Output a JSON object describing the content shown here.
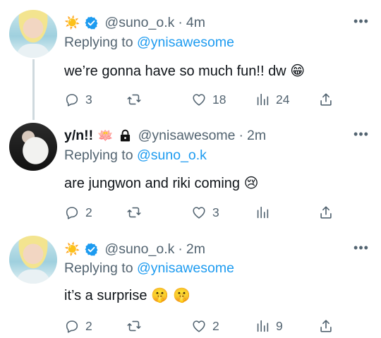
{
  "tweets": [
    {
      "display_name": "",
      "name_emoji": "☀️",
      "verified": true,
      "handle": "@suno_o.k",
      "time": "4m",
      "replying_prefix": "Replying to",
      "replying_to": "@ynisawesome",
      "text": "we’re gonna have so much fun!! dw ",
      "text_emoji": "😁",
      "counts": {
        "replies": "3",
        "retweets": "",
        "likes": "18",
        "views": "24"
      }
    },
    {
      "display_name": "y/n!!",
      "name_emoji": "🪷",
      "verified": false,
      "handle": "@ynisawesome",
      "time": "2m",
      "replying_prefix": "Replying to",
      "replying_to": "@suno_o.k",
      "text": "are jungwon and riki coming ",
      "text_emoji": "😢",
      "counts": {
        "replies": "2",
        "retweets": "",
        "likes": "3",
        "views": ""
      }
    },
    {
      "display_name": "",
      "name_emoji": "☀️",
      "verified": true,
      "handle": "@suno_o.k",
      "time": "2m",
      "replying_prefix": "Replying to",
      "replying_to": "@ynisawesome",
      "text": "it’s a surprise ",
      "text_emoji": "🤫 🤫",
      "counts": {
        "replies": "2",
        "retweets": "",
        "likes": "2",
        "views": "9"
      }
    }
  ],
  "more_glyph": "•••",
  "colors": {
    "accent": "#1d9bf0",
    "muted": "#536471",
    "text": "#0f1419",
    "thread": "#cfd9de"
  },
  "icons": [
    "reply-icon",
    "retweet-icon",
    "like-icon",
    "views-icon",
    "share-icon",
    "verified-badge-icon",
    "lock-icon",
    "more-icon"
  ]
}
